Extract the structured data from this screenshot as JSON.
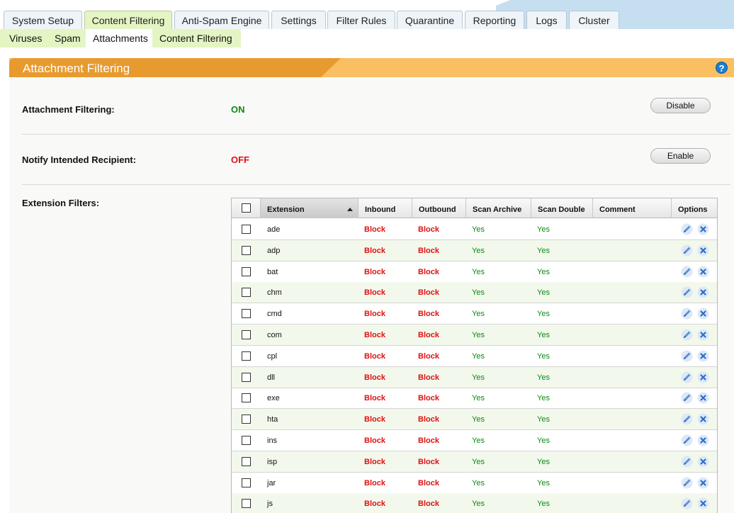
{
  "top_tabs": [
    {
      "label": "System Setup",
      "active": false
    },
    {
      "label": "Content Filtering",
      "active": true
    },
    {
      "label": "Anti-Spam Engine",
      "active": false
    },
    {
      "label": "Settings",
      "active": false
    },
    {
      "label": "Filter Rules",
      "active": false
    },
    {
      "label": "Quarantine",
      "active": false
    },
    {
      "label": "Reporting",
      "active": false
    },
    {
      "label": "Logs",
      "active": false
    },
    {
      "label": "Cluster",
      "active": false
    }
  ],
  "sub_tabs": [
    {
      "label": "Viruses",
      "active": false
    },
    {
      "label": "Spam",
      "active": false
    },
    {
      "label": "Attachments",
      "active": true
    },
    {
      "label": "Content Filtering",
      "active": false
    }
  ],
  "panel": {
    "title": "Attachment Filtering",
    "help_glyph": "?"
  },
  "settings": {
    "attachment_filtering": {
      "label": "Attachment Filtering:",
      "status": "ON",
      "button": "Disable"
    },
    "notify_recipient": {
      "label": "Notify Intended Recipient:",
      "status": "OFF",
      "button": "Enable"
    },
    "extension_filters_label": "Extension Filters:"
  },
  "colors": {
    "on": "#0c8a12",
    "off": "#e01010",
    "accent_orange": "#e89a2f",
    "tab_green": "#e4f5c4"
  },
  "table": {
    "columns": [
      "Extension",
      "Inbound",
      "Outbound",
      "Scan Archive",
      "Scan Double",
      "Comment",
      "Options"
    ],
    "sorted_column": "Extension",
    "sort_direction": "ascending",
    "rows": [
      {
        "ext": "ade",
        "inbound": "Block",
        "outbound": "Block",
        "scan_archive": "Yes",
        "scan_double": "Yes",
        "comment": ""
      },
      {
        "ext": "adp",
        "inbound": "Block",
        "outbound": "Block",
        "scan_archive": "Yes",
        "scan_double": "Yes",
        "comment": ""
      },
      {
        "ext": "bat",
        "inbound": "Block",
        "outbound": "Block",
        "scan_archive": "Yes",
        "scan_double": "Yes",
        "comment": ""
      },
      {
        "ext": "chm",
        "inbound": "Block",
        "outbound": "Block",
        "scan_archive": "Yes",
        "scan_double": "Yes",
        "comment": ""
      },
      {
        "ext": "cmd",
        "inbound": "Block",
        "outbound": "Block",
        "scan_archive": "Yes",
        "scan_double": "Yes",
        "comment": ""
      },
      {
        "ext": "com",
        "inbound": "Block",
        "outbound": "Block",
        "scan_archive": "Yes",
        "scan_double": "Yes",
        "comment": ""
      },
      {
        "ext": "cpl",
        "inbound": "Block",
        "outbound": "Block",
        "scan_archive": "Yes",
        "scan_double": "Yes",
        "comment": ""
      },
      {
        "ext": "dll",
        "inbound": "Block",
        "outbound": "Block",
        "scan_archive": "Yes",
        "scan_double": "Yes",
        "comment": ""
      },
      {
        "ext": "exe",
        "inbound": "Block",
        "outbound": "Block",
        "scan_archive": "Yes",
        "scan_double": "Yes",
        "comment": ""
      },
      {
        "ext": "hta",
        "inbound": "Block",
        "outbound": "Block",
        "scan_archive": "Yes",
        "scan_double": "Yes",
        "comment": ""
      },
      {
        "ext": "ins",
        "inbound": "Block",
        "outbound": "Block",
        "scan_archive": "Yes",
        "scan_double": "Yes",
        "comment": ""
      },
      {
        "ext": "isp",
        "inbound": "Block",
        "outbound": "Block",
        "scan_archive": "Yes",
        "scan_double": "Yes",
        "comment": ""
      },
      {
        "ext": "jar",
        "inbound": "Block",
        "outbound": "Block",
        "scan_archive": "Yes",
        "scan_double": "Yes",
        "comment": ""
      },
      {
        "ext": "js",
        "inbound": "Block",
        "outbound": "Block",
        "scan_archive": "Yes",
        "scan_double": "Yes",
        "comment": ""
      }
    ],
    "row_icons": [
      "edit-icon",
      "delete-icon"
    ]
  }
}
